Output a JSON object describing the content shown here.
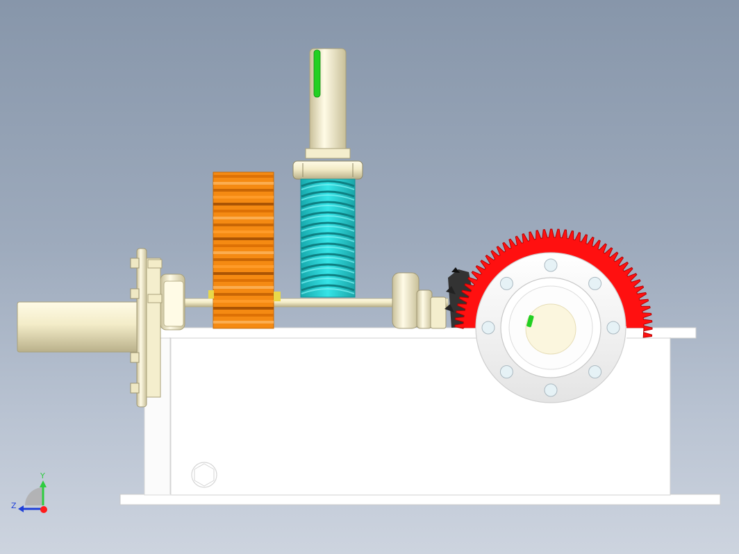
{
  "viewport": {
    "background_top": "#8796aa",
    "background_bottom": "#cdd4df"
  },
  "triad": {
    "y_label": "Y",
    "z_label": "Z",
    "y_color": "#2ecc40",
    "z_color": "#1f3fd8",
    "x_color": "#ff1a1a"
  },
  "colors": {
    "housing": "#ffffff",
    "shaft": "#f2ecc9",
    "spur_gear": "#f58a12",
    "worm": "#22d3d6",
    "worm_wheel": "#ff1010",
    "key": "#22d022"
  },
  "icons": {
    "axis_triad": "axis-triad-icon"
  }
}
